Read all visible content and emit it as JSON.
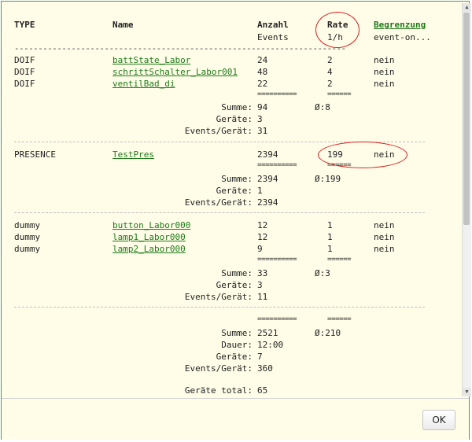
{
  "header": {
    "type": "TYPE",
    "name": "Name",
    "anzahl": "Anzahl",
    "anzahl_sub": "Events",
    "rate": "Rate",
    "rate_sub": "1/h",
    "begrenzung": "Begrenzung",
    "begrenzung_sub": "event-on..."
  },
  "separator_header": "----------------------------------------------------------------------",
  "groups": [
    {
      "rows": [
        {
          "type": "DOIF",
          "name": "battState_Labor",
          "anzahl": "24",
          "rate": "2",
          "begrenzung": "nein"
        },
        {
          "type": "DOIF",
          "name": "schrittSchalter_Labor001",
          "anzahl": "48",
          "rate": "4",
          "begrenzung": "nein"
        },
        {
          "type": "DOIF",
          "name": "ventilBad_di",
          "anzahl": "22",
          "rate": "2",
          "begrenzung": "nein"
        }
      ],
      "eq_anzahl": "==========",
      "eq_rate": "======",
      "summe_label": "Summe:",
      "summe": "94",
      "avg_rate": "Ø:8",
      "geraete_label": "Geräte:",
      "geraete": "3",
      "events_label": "Events/Gerät:",
      "events": "31"
    },
    {
      "rows": [
        {
          "type": "PRESENCE",
          "name": "TestPres",
          "anzahl": "2394",
          "rate": "199",
          "begrenzung": "nein"
        }
      ],
      "eq_anzahl": "==========",
      "eq_rate": "======",
      "summe_label": "Summe:",
      "summe": "2394",
      "avg_rate": "Ø:199",
      "geraete_label": "Geräte:",
      "geraete": "1",
      "events_label": "Events/Gerät:",
      "events": "2394"
    },
    {
      "rows": [
        {
          "type": "dummy",
          "name": "button_Labor000",
          "anzahl": "12",
          "rate": "1",
          "begrenzung": "nein"
        },
        {
          "type": "dummy",
          "name": "lamp1_Labor000",
          "anzahl": "12",
          "rate": "1",
          "begrenzung": "nein"
        },
        {
          "type": "dummy",
          "name": "lamp2_Labor000",
          "anzahl": "9",
          "rate": "1",
          "begrenzung": "nein"
        }
      ],
      "eq_anzahl": "==========",
      "eq_rate": "======",
      "summe_label": "Summe:",
      "summe": "33",
      "avg_rate": "Ø:3",
      "geraete_label": "Geräte:",
      "geraete": "3",
      "events_label": "Events/Gerät:",
      "events": "11"
    }
  ],
  "totals": {
    "eq_anzahl": "==========",
    "eq_rate": "======",
    "summe_label": "Summe:",
    "summe": "2521",
    "avg_rate": "Ø:210",
    "dauer_label": "Dauer:",
    "dauer": "12:00",
    "geraete_label": "Geräte:",
    "geraete": "7",
    "events_label": "Events/Gerät:",
    "events": "360",
    "geraete_total_label": "Geräte total:",
    "geraete_total": "65"
  },
  "footer": {
    "ok_label": "OK"
  },
  "colors": {
    "accent": "#1d7a17",
    "annotation": "#dd1c1c",
    "background": "#fffde8"
  }
}
